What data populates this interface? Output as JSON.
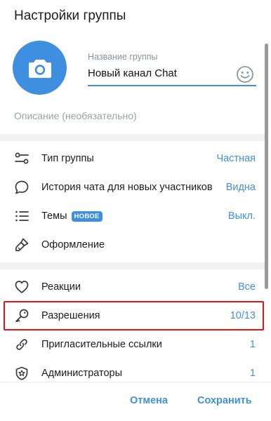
{
  "dialog": {
    "title": "Настройки группы"
  },
  "group": {
    "name_label": "Название группы",
    "name_value": "Новый канал Chat",
    "description_placeholder": "Описание (необязательно)"
  },
  "settings": [
    {
      "label": "Тип группы",
      "value": "Частная",
      "icon": "sliders-icon"
    },
    {
      "label": "История чата для новых участников",
      "value": "Видна",
      "icon": "chat-bubble-icon"
    },
    {
      "label": "Темы",
      "badge": "НОВОЕ",
      "value": "Выкл.",
      "icon": "list-icon"
    },
    {
      "label": "Оформление",
      "value": "",
      "icon": "brush-icon"
    }
  ],
  "permissions": [
    {
      "label": "Реакции",
      "value": "Все",
      "icon": "heart-icon"
    },
    {
      "label": "Разрешения",
      "value": "10/13",
      "icon": "key-icon"
    },
    {
      "label": "Пригласительные ссылки",
      "value": "1",
      "icon": "link-icon"
    },
    {
      "label": "Администраторы",
      "value": "1",
      "icon": "shield-star-icon"
    }
  ],
  "footer": {
    "cancel_label": "Отмена",
    "save_label": "Сохранить"
  },
  "colors": {
    "accent": "#3f8fe0",
    "highlight": "#e8101a"
  }
}
